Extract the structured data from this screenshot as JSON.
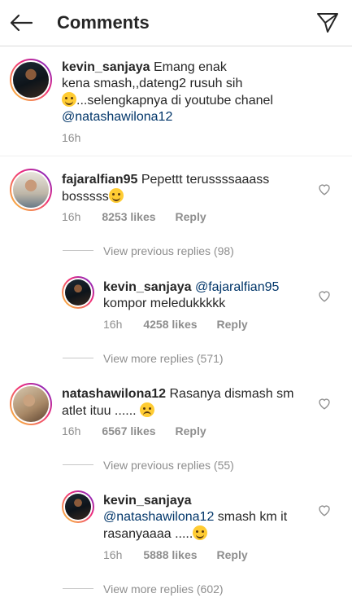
{
  "header": {
    "title": "Comments",
    "back_icon": "back-arrow-icon",
    "send_icon": "send-icon"
  },
  "caption": {
    "username": "kevin_sanjaya",
    "text_part1": "Emang enak",
    "text_part2": "kena smash,,dateng2 rusuh sih",
    "text_part3": "...selengkapnya di youtube chanel",
    "mention": "@natashawilona12",
    "time": "16h"
  },
  "comments": [
    {
      "username": "fajaralfian95",
      "text_part1": "Pepettt terussssaaass",
      "text_part2": "bosssss",
      "time": "16h",
      "likes": "8253 likes",
      "reply": "Reply",
      "thread_link": "View previous replies (98)",
      "replies": [
        {
          "username": "kevin_sanjaya",
          "mention": "@fajaralfian95",
          "text": "kompor meledukkkkk",
          "time": "16h",
          "likes": "4258 likes",
          "reply": "Reply",
          "thread_link": "View more replies (571)"
        }
      ]
    },
    {
      "username": "natashawilona12",
      "text_part1": "Rasanya dismash sm",
      "text_part2": "atlet ituu ......",
      "time": "16h",
      "likes": "6567 likes",
      "reply": "Reply",
      "thread_link": "View previous replies (55)",
      "replies": [
        {
          "username": "kevin_sanjaya",
          "mention": "@natashawilona12",
          "text_part1": "smash km it",
          "text_part2": "rasanyaaaa .....",
          "time": "16h",
          "likes": "5888 likes",
          "reply": "Reply",
          "thread_link": "View more replies (602)"
        }
      ]
    }
  ],
  "colors": {
    "mention": "#003569",
    "muted": "#8e8e8e",
    "text": "#262626"
  }
}
